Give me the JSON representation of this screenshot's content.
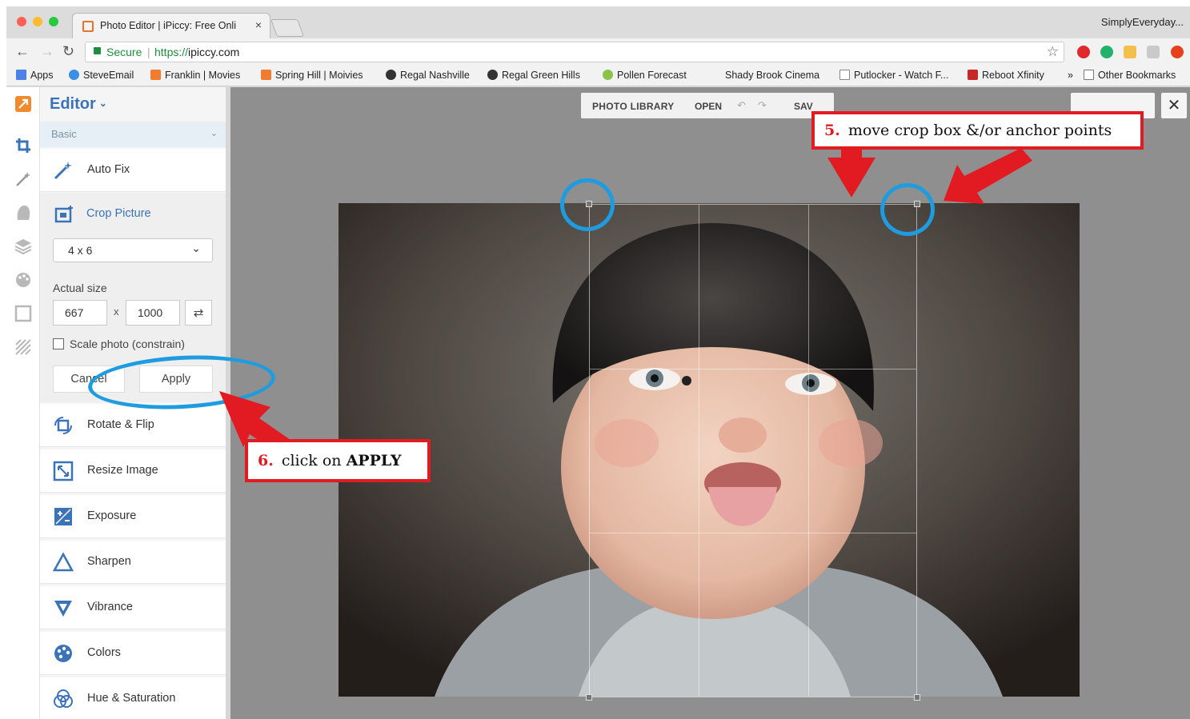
{
  "browser": {
    "tab_title": "Photo Editor | iPiccy: Free Onli",
    "tab_close": "×",
    "profile_name": "SimplyEveryday...",
    "secure_label": "Secure",
    "url_scheme": "https://",
    "url_host": "ipiccy.com",
    "bookmarks": [
      "Apps",
      "SteveEmail",
      "Franklin | Movies",
      "Spring Hill | Moivies",
      "Regal Nashville",
      "Regal Green Hills",
      "Pollen Forecast",
      "Shady Brook Cinema",
      "Putlocker - Watch F...",
      "Reboot Xfinity"
    ],
    "more_bookmarks": "»",
    "other_bookmarks": "Other Bookmarks"
  },
  "editor": {
    "title": "Editor",
    "section": "Basic",
    "auto_fix": "Auto Fix",
    "crop_picture": "Crop Picture",
    "crop_ratio": "4 x 6",
    "actual_size_label": "Actual size",
    "width": "667",
    "times": "x",
    "height": "1000",
    "scale_label": "Scale photo (constrain)",
    "cancel": "Cancel",
    "apply": "Apply",
    "tools": [
      "Rotate & Flip",
      "Resize Image",
      "Exposure",
      "Sharpen",
      "Vibrance",
      "Colors",
      "Hue & Saturation"
    ]
  },
  "canvas_toolbar": {
    "photo_library": "PHOTO LIBRARY",
    "open": "OPEN",
    "save": "SAV",
    "close": "✕"
  },
  "annotations": {
    "step5_num": "5.",
    "step5_text": "move crop box &/or anchor points",
    "step6_num": "6.",
    "step6_text": "click on",
    "step6_bold": "APPLY"
  },
  "colors": {
    "accent_blue": "#3b73b8",
    "annotation_red": "#e21b23",
    "annotation_circle": "#1f9be0"
  }
}
